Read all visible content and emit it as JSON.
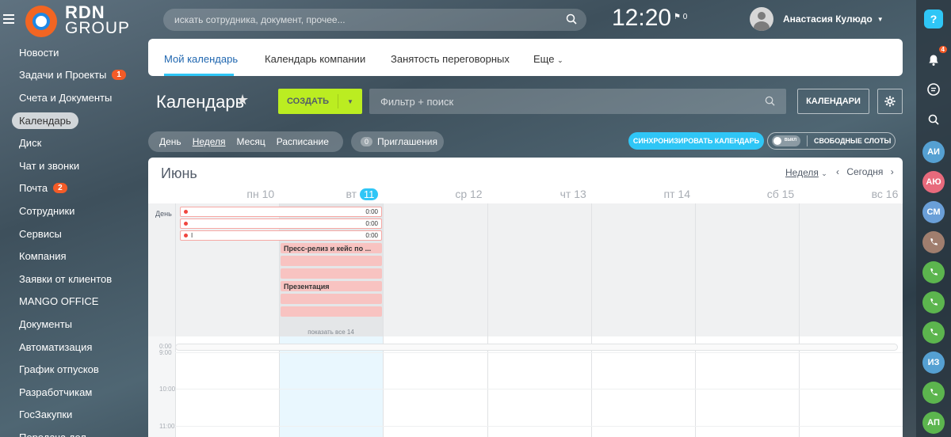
{
  "topbar": {
    "logo_line1": "RDN",
    "logo_line2": "GROUP",
    "search_placeholder": "искать сотрудника, документ, прочее...",
    "clock": "12:20",
    "flag_count": "0",
    "user_name": "Анастасия Кулюдо"
  },
  "left_menu": [
    {
      "label": "Новости"
    },
    {
      "label": "Задачи и Проекты",
      "badge": "1"
    },
    {
      "label": "Счета и Документы"
    },
    {
      "label": "Календарь",
      "active": true
    },
    {
      "label": "Диск"
    },
    {
      "label": "Чат и звонки"
    },
    {
      "label": "Почта",
      "badge": "2"
    },
    {
      "label": "Сотрудники"
    },
    {
      "label": "Сервисы"
    },
    {
      "label": "Компания"
    },
    {
      "label": "Заявки от клиентов"
    },
    {
      "label": "MANGO OFFICE"
    },
    {
      "label": "Документы"
    },
    {
      "label": "Автоматизация"
    },
    {
      "label": "График отпусков"
    },
    {
      "label": "Разработчикам"
    },
    {
      "label": "ГосЗакупки"
    },
    {
      "label": "Передача дел"
    }
  ],
  "tabs": {
    "my_calendar": "Мой календарь",
    "company_calendar": "Календарь компании",
    "rooms": "Занятость переговорных",
    "more": "Еще"
  },
  "toolbar": {
    "title": "Календарь",
    "create_label": "СОЗДАТЬ",
    "filter_placeholder": "Фильтр + поиск",
    "calendars_label": "КАЛЕНДАРИ"
  },
  "views": {
    "day": "День",
    "week": "Неделя",
    "month": "Месяц",
    "schedule": "Расписание",
    "invites_count": "0",
    "invites_label": "Приглашения",
    "sync_label": "СИНХРОНИЗИРОВАТЬ КАЛЕНДАРЬ",
    "toggle_label": "ВЫКЛ",
    "free_slots_label": "СВОБОДНЫЕ СЛОТЫ"
  },
  "calendar": {
    "month": "Июнь",
    "view_select": "Неделя",
    "nav_label": "Сегодня",
    "day_headers": [
      {
        "dow": "пн",
        "num": "10"
      },
      {
        "dow": "вт",
        "num": "11",
        "today": true
      },
      {
        "dow": "ср",
        "num": "12"
      },
      {
        "dow": "чт",
        "num": "13"
      },
      {
        "dow": "пт",
        "num": "14"
      },
      {
        "dow": "сб",
        "num": "15"
      },
      {
        "dow": "вс",
        "num": "16"
      }
    ],
    "allday_label": "День",
    "span_events": [
      {
        "time": "0:00"
      },
      {
        "time": "0:00"
      },
      {
        "title": "I",
        "time": "0:00"
      }
    ],
    "day_events": [
      {
        "title": "Пресс-релиз и кейс по ..."
      },
      {
        "title": ""
      },
      {
        "title": ""
      },
      {
        "title": "Презентация"
      },
      {
        "title": ""
      },
      {
        "title": ""
      }
    ],
    "show_all": "показать все 14",
    "time_labels": [
      "0:00",
      "9:00",
      "10:00",
      "11:00"
    ]
  },
  "right_bar": {
    "notif_badge": "4",
    "contacts": [
      {
        "initials": "АИ",
        "color": "#55a0d2"
      },
      {
        "initials": "АЮ",
        "color": "#e86a7c"
      },
      {
        "initials": "СМ",
        "color": "#6a9fd8"
      },
      {
        "initials": "",
        "color": "#a07e6e"
      },
      {
        "initials": "",
        "color": "#5cb54e"
      },
      {
        "initials": "",
        "color": "#5cb54e"
      },
      {
        "initials": "",
        "color": "#5cb54e"
      },
      {
        "initials": "ИЗ",
        "color": "#55a0d2"
      },
      {
        "initials": "",
        "color": "#5cb54e"
      },
      {
        "initials": "АП",
        "color": "#5cb54e"
      }
    ]
  }
}
